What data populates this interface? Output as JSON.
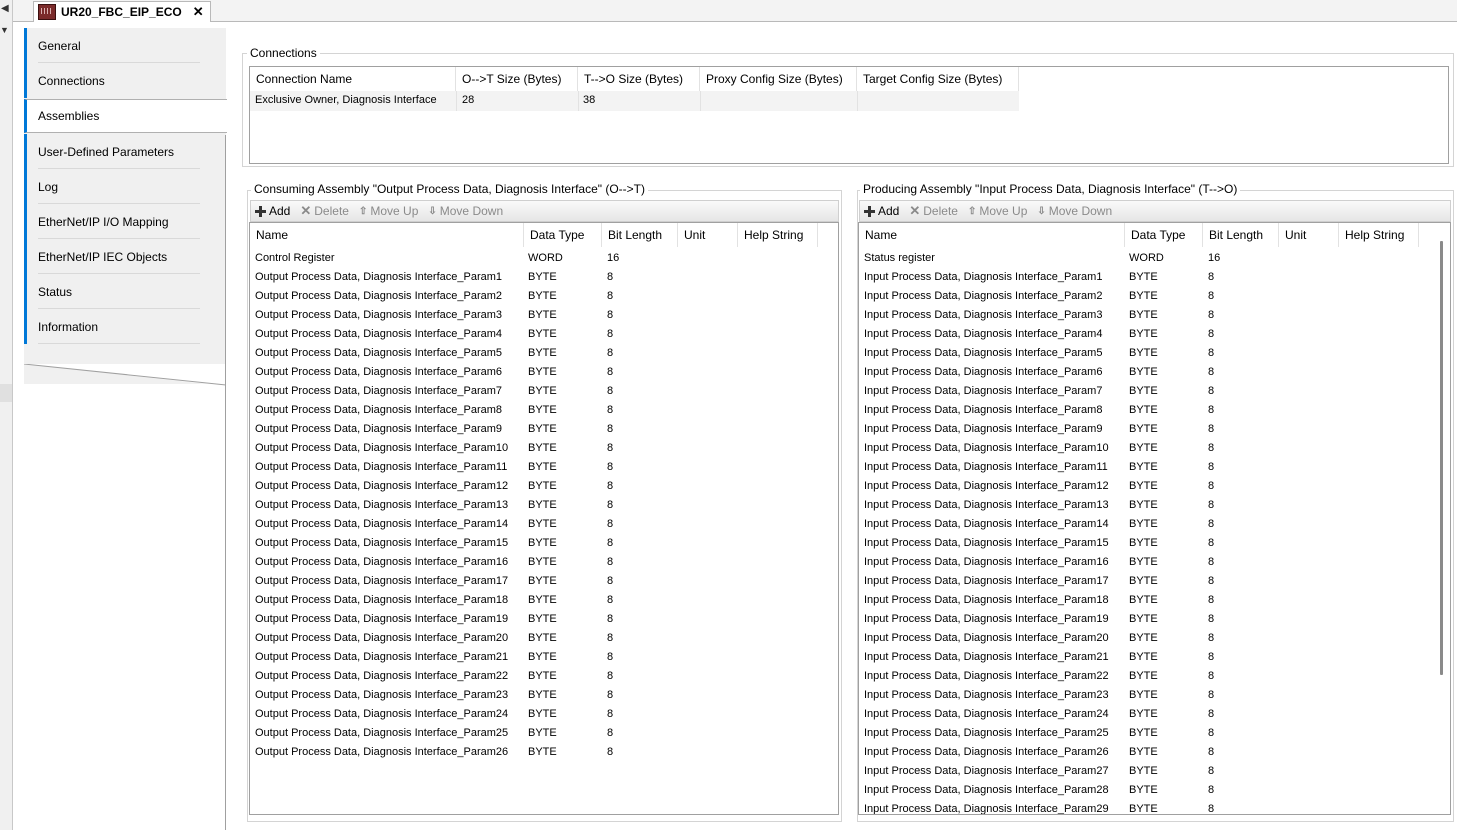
{
  "tab": {
    "title": "UR20_FBC_EIP_ECO",
    "close": "✕"
  },
  "left_strip": {
    "arrow_left": "◀",
    "arrow_down": "▼"
  },
  "sidebar": {
    "items": [
      {
        "label": "General"
      },
      {
        "label": "Connections"
      },
      {
        "label": "Assemblies"
      },
      {
        "label": "User-Defined Parameters"
      },
      {
        "label": "Log"
      },
      {
        "label": "EtherNet/IP I/O Mapping"
      },
      {
        "label": "EtherNet/IP IEC Objects"
      },
      {
        "label": "Status"
      },
      {
        "label": "Information"
      }
    ],
    "active": "Assemblies"
  },
  "connections": {
    "title": "Connections",
    "headers": [
      "Connection Name",
      "O-->T Size (Bytes)",
      "T-->O Size (Bytes)",
      "Proxy Config Size (Bytes)",
      "Target Config Size (Bytes)"
    ],
    "rows": [
      [
        "Exclusive Owner, Diagnosis Interface",
        "28",
        "38",
        "",
        ""
      ]
    ]
  },
  "consuming": {
    "title": "Consuming Assembly \"Output Process Data, Diagnosis Interface\" (O-->T)",
    "toolbar": {
      "add": "Add",
      "delete": "Delete",
      "move_up": "Move Up",
      "move_down": "Move Down"
    },
    "headers": [
      "Name",
      "Data Type",
      "Bit Length",
      "Unit",
      "Help String"
    ],
    "rows": [
      [
        "Control Register",
        "WORD",
        "16"
      ],
      [
        "Output Process Data, Diagnosis Interface_Param1",
        "BYTE",
        "8"
      ],
      [
        "Output Process Data, Diagnosis Interface_Param2",
        "BYTE",
        "8"
      ],
      [
        "Output Process Data, Diagnosis Interface_Param3",
        "BYTE",
        "8"
      ],
      [
        "Output Process Data, Diagnosis Interface_Param4",
        "BYTE",
        "8"
      ],
      [
        "Output Process Data, Diagnosis Interface_Param5",
        "BYTE",
        "8"
      ],
      [
        "Output Process Data, Diagnosis Interface_Param6",
        "BYTE",
        "8"
      ],
      [
        "Output Process Data, Diagnosis Interface_Param7",
        "BYTE",
        "8"
      ],
      [
        "Output Process Data, Diagnosis Interface_Param8",
        "BYTE",
        "8"
      ],
      [
        "Output Process Data, Diagnosis Interface_Param9",
        "BYTE",
        "8"
      ],
      [
        "Output Process Data, Diagnosis Interface_Param10",
        "BYTE",
        "8"
      ],
      [
        "Output Process Data, Diagnosis Interface_Param11",
        "BYTE",
        "8"
      ],
      [
        "Output Process Data, Diagnosis Interface_Param12",
        "BYTE",
        "8"
      ],
      [
        "Output Process Data, Diagnosis Interface_Param13",
        "BYTE",
        "8"
      ],
      [
        "Output Process Data, Diagnosis Interface_Param14",
        "BYTE",
        "8"
      ],
      [
        "Output Process Data, Diagnosis Interface_Param15",
        "BYTE",
        "8"
      ],
      [
        "Output Process Data, Diagnosis Interface_Param16",
        "BYTE",
        "8"
      ],
      [
        "Output Process Data, Diagnosis Interface_Param17",
        "BYTE",
        "8"
      ],
      [
        "Output Process Data, Diagnosis Interface_Param18",
        "BYTE",
        "8"
      ],
      [
        "Output Process Data, Diagnosis Interface_Param19",
        "BYTE",
        "8"
      ],
      [
        "Output Process Data, Diagnosis Interface_Param20",
        "BYTE",
        "8"
      ],
      [
        "Output Process Data, Diagnosis Interface_Param21",
        "BYTE",
        "8"
      ],
      [
        "Output Process Data, Diagnosis Interface_Param22",
        "BYTE",
        "8"
      ],
      [
        "Output Process Data, Diagnosis Interface_Param23",
        "BYTE",
        "8"
      ],
      [
        "Output Process Data, Diagnosis Interface_Param24",
        "BYTE",
        "8"
      ],
      [
        "Output Process Data, Diagnosis Interface_Param25",
        "BYTE",
        "8"
      ],
      [
        "Output Process Data, Diagnosis Interface_Param26",
        "BYTE",
        "8"
      ]
    ]
  },
  "producing": {
    "title": "Producing Assembly \"Input Process Data, Diagnosis Interface\" (T-->O)",
    "toolbar": {
      "add": "Add",
      "delete": "Delete",
      "move_up": "Move Up",
      "move_down": "Move Down"
    },
    "headers": [
      "Name",
      "Data Type",
      "Bit Length",
      "Unit",
      "Help String"
    ],
    "rows": [
      [
        "Status register",
        "WORD",
        "16"
      ],
      [
        "Input Process Data, Diagnosis Interface_Param1",
        "BYTE",
        "8"
      ],
      [
        "Input Process Data, Diagnosis Interface_Param2",
        "BYTE",
        "8"
      ],
      [
        "Input Process Data, Diagnosis Interface_Param3",
        "BYTE",
        "8"
      ],
      [
        "Input Process Data, Diagnosis Interface_Param4",
        "BYTE",
        "8"
      ],
      [
        "Input Process Data, Diagnosis Interface_Param5",
        "BYTE",
        "8"
      ],
      [
        "Input Process Data, Diagnosis Interface_Param6",
        "BYTE",
        "8"
      ],
      [
        "Input Process Data, Diagnosis Interface_Param7",
        "BYTE",
        "8"
      ],
      [
        "Input Process Data, Diagnosis Interface_Param8",
        "BYTE",
        "8"
      ],
      [
        "Input Process Data, Diagnosis Interface_Param9",
        "BYTE",
        "8"
      ],
      [
        "Input Process Data, Diagnosis Interface_Param10",
        "BYTE",
        "8"
      ],
      [
        "Input Process Data, Diagnosis Interface_Param11",
        "BYTE",
        "8"
      ],
      [
        "Input Process Data, Diagnosis Interface_Param12",
        "BYTE",
        "8"
      ],
      [
        "Input Process Data, Diagnosis Interface_Param13",
        "BYTE",
        "8"
      ],
      [
        "Input Process Data, Diagnosis Interface_Param14",
        "BYTE",
        "8"
      ],
      [
        "Input Process Data, Diagnosis Interface_Param15",
        "BYTE",
        "8"
      ],
      [
        "Input Process Data, Diagnosis Interface_Param16",
        "BYTE",
        "8"
      ],
      [
        "Input Process Data, Diagnosis Interface_Param17",
        "BYTE",
        "8"
      ],
      [
        "Input Process Data, Diagnosis Interface_Param18",
        "BYTE",
        "8"
      ],
      [
        "Input Process Data, Diagnosis Interface_Param19",
        "BYTE",
        "8"
      ],
      [
        "Input Process Data, Diagnosis Interface_Param20",
        "BYTE",
        "8"
      ],
      [
        "Input Process Data, Diagnosis Interface_Param21",
        "BYTE",
        "8"
      ],
      [
        "Input Process Data, Diagnosis Interface_Param22",
        "BYTE",
        "8"
      ],
      [
        "Input Process Data, Diagnosis Interface_Param23",
        "BYTE",
        "8"
      ],
      [
        "Input Process Data, Diagnosis Interface_Param24",
        "BYTE",
        "8"
      ],
      [
        "Input Process Data, Diagnosis Interface_Param25",
        "BYTE",
        "8"
      ],
      [
        "Input Process Data, Diagnosis Interface_Param26",
        "BYTE",
        "8"
      ],
      [
        "Input Process Data, Diagnosis Interface_Param27",
        "BYTE",
        "8"
      ],
      [
        "Input Process Data, Diagnosis Interface_Param28",
        "BYTE",
        "8"
      ],
      [
        "Input Process Data, Diagnosis Interface_Param29",
        "BYTE",
        "8"
      ]
    ]
  }
}
